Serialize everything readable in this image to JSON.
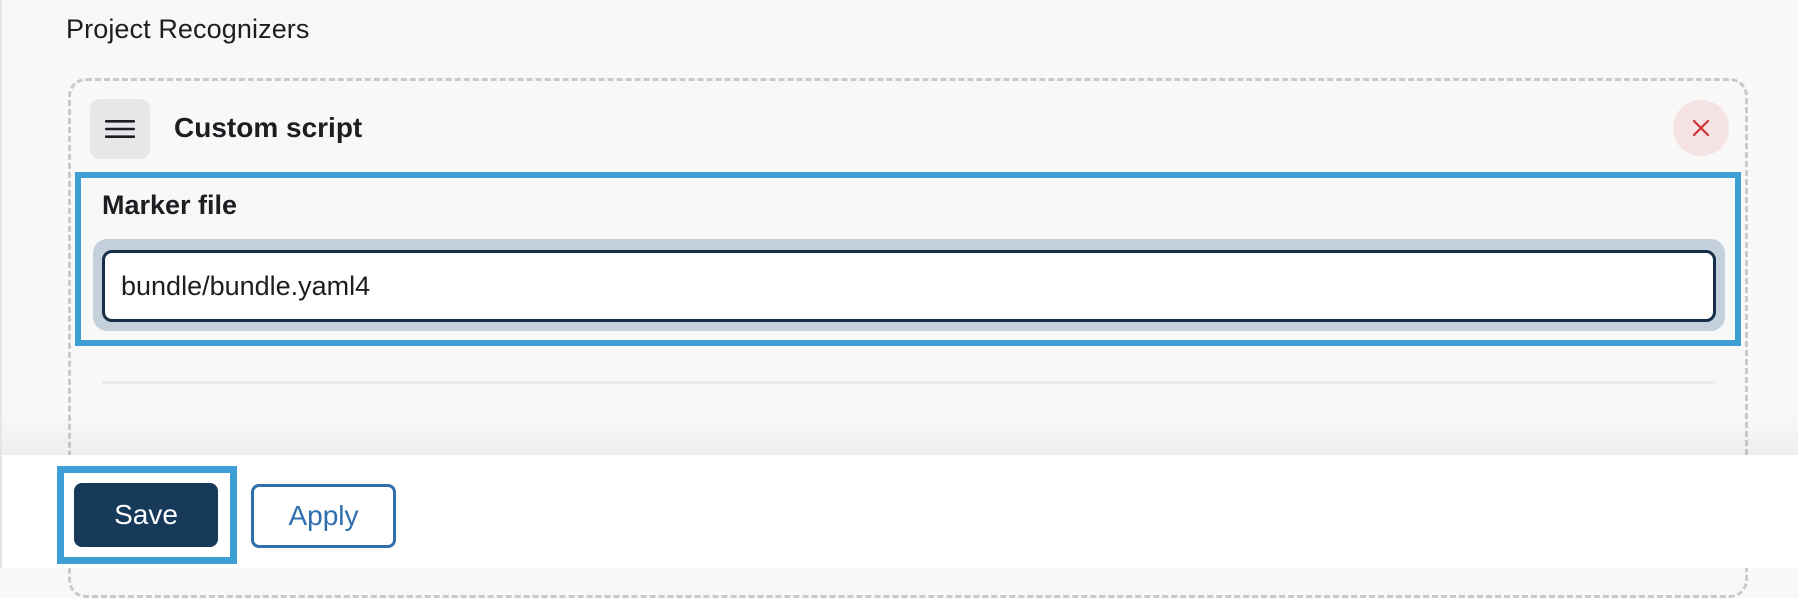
{
  "section": {
    "title": "Project Recognizers"
  },
  "recognizer": {
    "title": "Custom script",
    "drag_icon": "hamburger-menu-icon",
    "remove_icon": "close-x-icon",
    "marker_file": {
      "label": "Marker file",
      "value": "bundle/bundle.yaml4"
    }
  },
  "actions": {
    "save_label": "Save",
    "apply_label": "Apply"
  },
  "colors": {
    "primary": "#173a5a",
    "link": "#2f6fae",
    "highlight": "#3d9fd6",
    "danger": "#d1343a"
  }
}
